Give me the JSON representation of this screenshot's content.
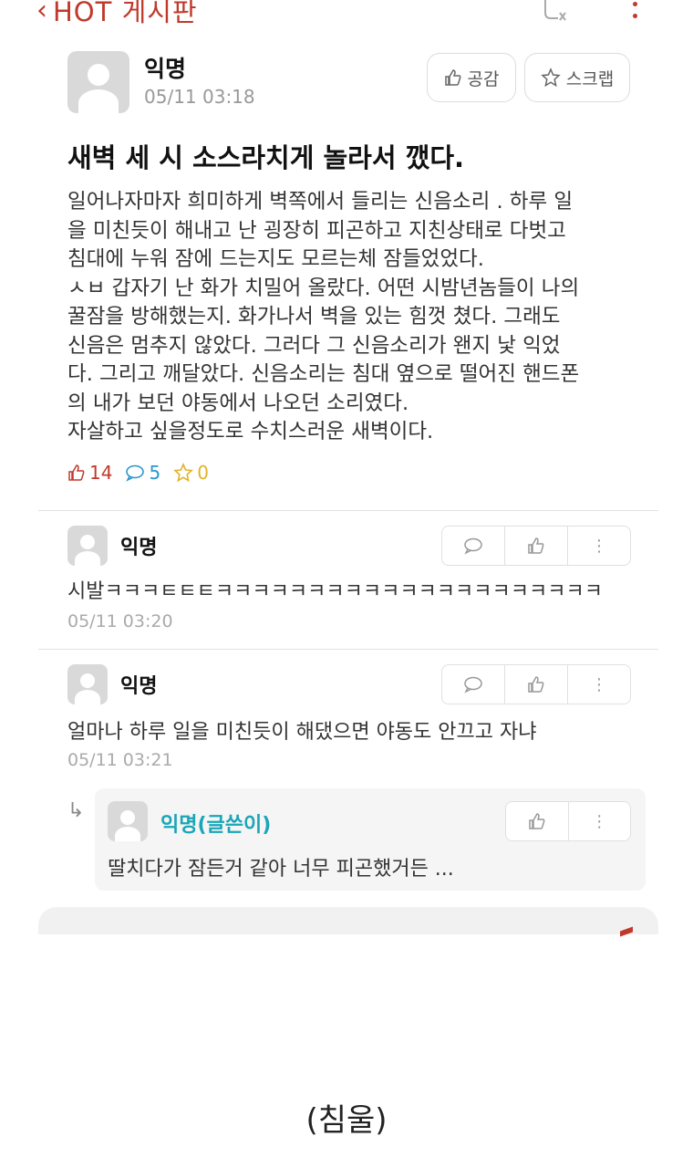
{
  "header": {
    "back_label": "HOT 게시판"
  },
  "post": {
    "author": "익명",
    "time": "05/11 03:18",
    "like_button": "공감",
    "scrap_button": "스크랩",
    "title": "새벽 세 시 소스라치게 놀라서 깼다.",
    "body_lines": [
      "일어나자마자 희미하게 벽쪽에서 들리는 신음소리 . 하루 일",
      "을 미친듯이 해내고 난 굉장히 피곤하고 지친상태로 다벗고",
      "침대에 누워  잠에 드는지도 모르는체 잠들었었다.",
      "ㅅㅂ 갑자기 난 화가 치밀어 올랐다. 어떤 시밤년놈들이 나의",
      "꿀잠을 방해했는지.  화가나서 벽을 있는 힘껏 쳤다. 그래도",
      "신음은 멈추지 않았다. 그러다 그 신음소리가 왠지 낯 익었",
      "다. 그리고 깨달았다. 신음소리는 침대 옆으로 떨어진 핸드폰",
      "의 내가 보던 야동에서 나오던 소리였다.",
      "자살하고 싶을정도로 수치스러운 새벽이다."
    ],
    "likes": "14",
    "comments": "5",
    "scraps": "0"
  },
  "comments": [
    {
      "author": "익명",
      "text": "시발ㅋㅋㅋㅌㅌㅌㅋㅋㅋㅋㅋㅋㅋㅋㅋㅋㅋㅋㅋㅋㅋㅋㅋㅋㅋㅋㅋ",
      "time": "05/11 03:20"
    },
    {
      "author": "익명",
      "text": "얼마나 하루 일을 미친듯이 해댔으면 야동도 안끄고 자냐",
      "time": "05/11 03:21"
    }
  ],
  "reply": {
    "author": "익명(글쓴이)",
    "text": "딸치다가 잠든거 같아 너무 피곤했거든 ..."
  },
  "caption": "(침울)",
  "colors": {
    "accent": "#c0392b",
    "comment_blue": "#2b97cf",
    "scrap_yellow": "#e2b32a",
    "writer_teal": "#1aa6b7"
  }
}
